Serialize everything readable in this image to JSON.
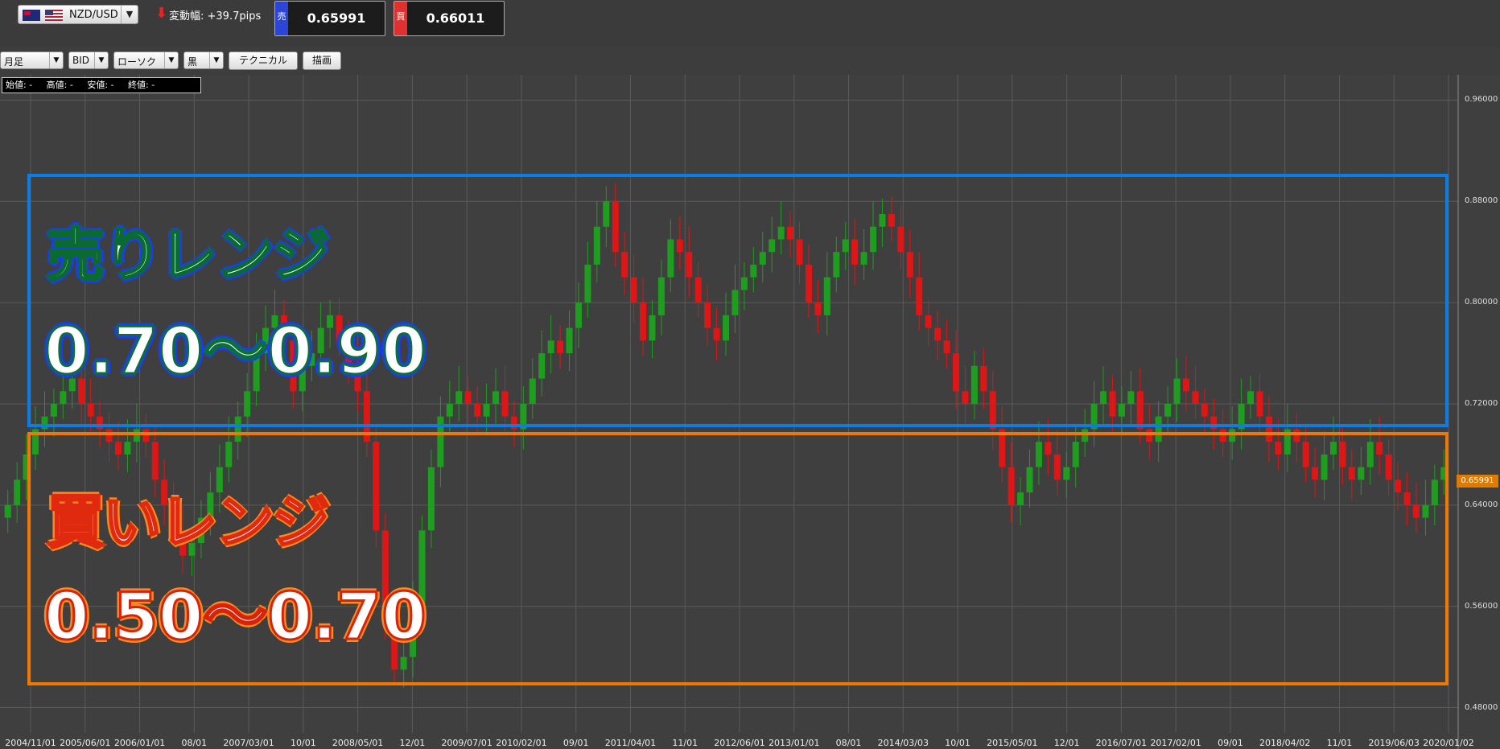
{
  "header": {
    "pair": "NZD/USD",
    "change_text": "変動幅: +39.7pips",
    "sell": {
      "tag": "売",
      "price": "0.65991"
    },
    "buy": {
      "tag": "買",
      "price": "0.66011"
    }
  },
  "toolbar": {
    "timeframe": "月足",
    "price_type": "BID",
    "chart_style": "ローソク",
    "theme": "黒",
    "technical_label": "テクニカル",
    "draw_label": "描画"
  },
  "ohlc": {
    "open": "始値: -",
    "high": "高値: -",
    "low": "安値: -",
    "close": "終値: -"
  },
  "overlay": {
    "sell_title": "売りレンジ",
    "sell_range": "0.70～0.90",
    "buy_title": "買いレンジ",
    "buy_range": "0.50～0.70"
  },
  "colors": {
    "up": "#1e9e1e",
    "down": "#e01515",
    "sell_box": "#0a7de8",
    "buy_box": "#f07800",
    "current": "#e07a00"
  },
  "chart_data": {
    "type": "candlestick",
    "current_price_label": "0.65991",
    "ylim": [
      0.46,
      0.98
    ],
    "yticks": [
      "0.96000",
      "0.88000",
      "0.80000",
      "0.72000",
      "0.64000",
      "0.56000",
      "0.48000"
    ],
    "xticks": [
      "2004/11/01",
      "2005/06/01",
      "2006/01/01",
      "08/01",
      "2007/03/01",
      "10/01",
      "2008/05/01",
      "12/01",
      "2009/07/01",
      "2010/02/01",
      "09/01",
      "2011/04/01",
      "11/01",
      "2012/06/01",
      "2013/01/01",
      "08/01",
      "2014/03/03",
      "10/01",
      "2015/05/01",
      "12/01",
      "2016/07/01",
      "2017/02/01",
      "09/01",
      "2018/04/02",
      "11/01",
      "2019/06/03",
      "2020/01/02"
    ],
    "close_path": [
      0.64,
      0.66,
      0.68,
      0.7,
      0.71,
      0.72,
      0.73,
      0.74,
      0.72,
      0.71,
      0.7,
      0.69,
      0.68,
      0.69,
      0.7,
      0.69,
      0.66,
      0.64,
      0.62,
      0.6,
      0.61,
      0.63,
      0.65,
      0.67,
      0.69,
      0.71,
      0.73,
      0.76,
      0.78,
      0.79,
      0.77,
      0.73,
      0.75,
      0.76,
      0.78,
      0.79,
      0.77,
      0.75,
      0.73,
      0.69,
      0.62,
      0.55,
      0.51,
      0.52,
      0.56,
      0.62,
      0.67,
      0.71,
      0.72,
      0.73,
      0.72,
      0.71,
      0.72,
      0.73,
      0.71,
      0.7,
      0.72,
      0.74,
      0.76,
      0.77,
      0.76,
      0.78,
      0.8,
      0.83,
      0.86,
      0.88,
      0.84,
      0.82,
      0.8,
      0.77,
      0.79,
      0.82,
      0.85,
      0.84,
      0.82,
      0.8,
      0.78,
      0.77,
      0.79,
      0.81,
      0.82,
      0.83,
      0.84,
      0.85,
      0.86,
      0.85,
      0.83,
      0.8,
      0.79,
      0.82,
      0.84,
      0.85,
      0.83,
      0.84,
      0.86,
      0.87,
      0.86,
      0.84,
      0.82,
      0.79,
      0.78,
      0.77,
      0.76,
      0.73,
      0.72,
      0.75,
      0.73,
      0.7,
      0.67,
      0.64,
      0.65,
      0.67,
      0.69,
      0.68,
      0.66,
      0.67,
      0.69,
      0.7,
      0.72,
      0.73,
      0.71,
      0.72,
      0.73,
      0.7,
      0.69,
      0.71,
      0.72,
      0.74,
      0.73,
      0.72,
      0.71,
      0.7,
      0.69,
      0.7,
      0.72,
      0.73,
      0.71,
      0.69,
      0.68,
      0.7,
      0.69,
      0.67,
      0.66,
      0.68,
      0.69,
      0.67,
      0.66,
      0.67,
      0.69,
      0.68,
      0.66,
      0.65,
      0.64,
      0.63,
      0.64,
      0.66,
      0.67
    ]
  }
}
